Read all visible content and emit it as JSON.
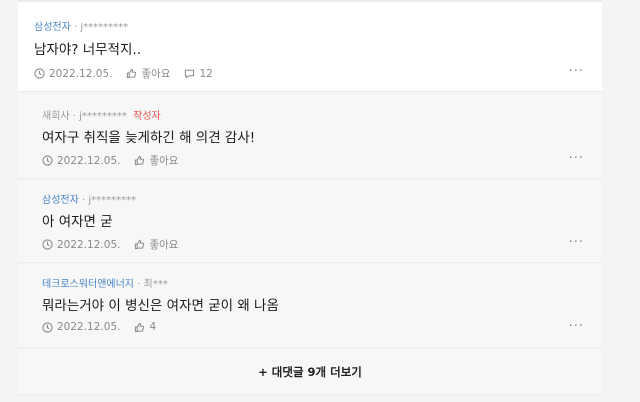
{
  "comments": [
    {
      "company": "삼성전자",
      "user": "· j*********",
      "author_badge": "",
      "text": "남자야? 너무적지..",
      "date": "2022.12.05.",
      "like_label": "좋아요",
      "reply_count": "12",
      "more": "···"
    },
    {
      "company": "새회사",
      "user": "· j*********",
      "author_badge": "작성자",
      "text": "여자구 취직을 늦게하긴 해 의견 감사!",
      "date": "2022.12.05.",
      "like_label": "좋아요",
      "more": "···"
    },
    {
      "company": "삼성전자",
      "user": "· j*********",
      "author_badge": "",
      "text": "아 여자면 굳",
      "date": "2022.12.05.",
      "like_label": "좋아요",
      "more": "···"
    },
    {
      "company": "테크로스워터앤에너지",
      "user": "· 최***",
      "author_badge": "",
      "text": "뭐라는거야 이 병신은 여자면 굳이 왜 나옴",
      "date": "2022.12.05.",
      "like_label": "4",
      "more": "···"
    }
  ],
  "load_more": {
    "label": "+ 대댓글 9개 더보기"
  },
  "colors": {
    "company": "#4a86c5",
    "author_badge": "#e2564e",
    "reply_bg": "#f7f7f8"
  },
  "icons": [
    "clock-icon",
    "thumbs-up-icon",
    "speech-bubble-icon",
    "more-icon"
  ]
}
